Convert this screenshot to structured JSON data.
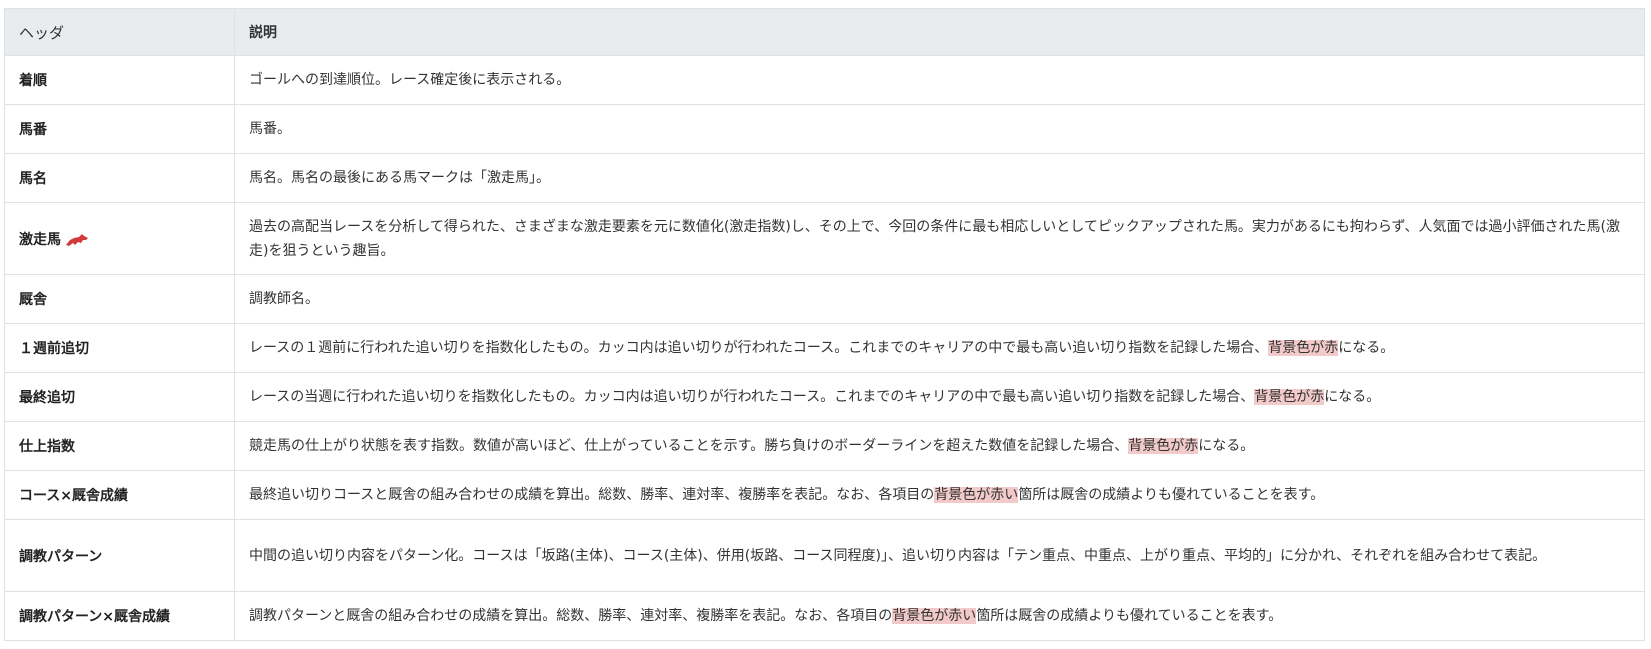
{
  "header": {
    "col1": "ヘッダ",
    "col2": "説明"
  },
  "rows": [
    {
      "label": "着順",
      "desc": "ゴールへの到達順位。レース確定後に表示される。"
    },
    {
      "label": "馬番",
      "desc": "馬番。"
    },
    {
      "label": "馬名",
      "desc": "馬名。馬名の最後にある馬マークは「激走馬」。"
    },
    {
      "label": "激走馬",
      "icon": "horse-mark-icon",
      "desc": "過去の高配当レースを分析して得られた、さまざまな激走要素を元に数値化(激走指数)し、その上で、今回の条件に最も相応しいとしてピックアップされた馬。実力があるにも拘わらず、人気面では過小評価された馬(激走)を狙うという趣旨。"
    },
    {
      "label": "厩舎",
      "desc": "調教師名。"
    },
    {
      "label": "１週前追切",
      "desc_pre": "レースの１週前に行われた追い切りを指数化したもの。カッコ内は追い切りが行われたコース。これまでのキャリアの中で最も高い追い切り指数を記録した場合、",
      "desc_hl": "背景色が赤",
      "desc_post": "になる。"
    },
    {
      "label": "最終追切",
      "desc_pre": "レースの当週に行われた追い切りを指数化したもの。カッコ内は追い切りが行われたコース。これまでのキャリアの中で最も高い追い切り指数を記録した場合、",
      "desc_hl": "背景色が赤",
      "desc_post": "になる。"
    },
    {
      "label": "仕上指数",
      "desc_pre": "競走馬の仕上がり状態を表す指数。数値が高いほど、仕上がっていることを示す。勝ち負けのボーダーラインを超えた数値を記録した場合、",
      "desc_hl": "背景色が赤",
      "desc_post": "になる。"
    },
    {
      "label": "コース×厩舎成績",
      "desc_pre": "最終追い切りコースと厩舎の組み合わせの成績を算出。総数、勝率、連対率、複勝率を表記。なお、各項目の",
      "desc_hl": "背景色が赤い",
      "desc_post": "箇所は厩舎の成績よりも優れていることを表す。"
    },
    {
      "label": "調教パターン",
      "desc": "中間の追い切り内容をパターン化。コースは「坂路(主体)、コース(主体)、併用(坂路、コース同程度)」、追い切り内容は「テン重点、中重点、上がり重点、平均的」に分かれ、それぞれを組み合わせて表記。"
    },
    {
      "label": "調教パターン×厩舎成績",
      "desc_pre": "調教パターンと厩舎の組み合わせの成績を算出。総数、勝率、連対率、複勝率を表記。なお、各項目の",
      "desc_hl": "背景色が赤い",
      "desc_post": "箇所は厩舎の成績よりも優れていることを表す。"
    }
  ],
  "colors": {
    "header_bg": "#e9ecef",
    "border": "#dee2e6",
    "highlight": "#f2caca",
    "horse_mark": "#d23a3a"
  }
}
